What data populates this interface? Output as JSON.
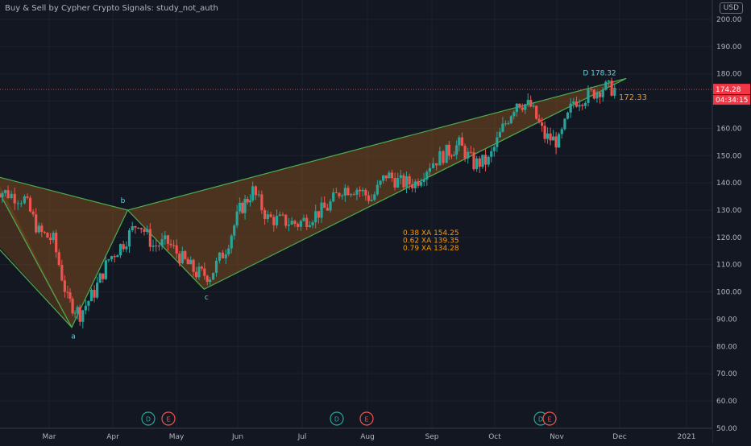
{
  "header": {
    "indicator_title": "Buy & Sell by Cypher Crypto Signals: study_not_auth",
    "currency": "USD"
  },
  "price_axis": {
    "ticks": [
      "200.00",
      "190.00",
      "180.00",
      "170.00",
      "160.00",
      "150.00",
      "140.00",
      "130.00",
      "120.00",
      "110.00",
      "100.00",
      "90.00",
      "80.00",
      "70.00",
      "60.00",
      "50.00"
    ],
    "current_price": "174.28",
    "countdown": "04:34:15"
  },
  "time_axis": {
    "labels": [
      "Mar",
      "Apr",
      "May",
      "Jun",
      "Jul",
      "Aug",
      "Sep",
      "Oct",
      "Nov",
      "Dec",
      "2021"
    ]
  },
  "pattern": {
    "points": [
      {
        "label": "",
        "x": "Feb 1",
        "y": 143
      },
      {
        "label": "a",
        "x": "Mar 12",
        "y": 87
      },
      {
        "label": "b",
        "x": "Apr 8",
        "y": 130
      },
      {
        "label": "c",
        "x": "May 15",
        "y": 101
      },
      {
        "label": "D 178.32",
        "x": "Dec 4",
        "y": 178.32
      }
    ],
    "fill_color": "#7a4a1e",
    "line_color": "#4caf50"
  },
  "fib_levels": [
    {
      "text": "0.38 XA  154.25"
    },
    {
      "text": "0.62 XA  139.35"
    },
    {
      "text": "0.79 XA  134.28"
    }
  ],
  "target_label": "172.33",
  "events": [
    {
      "type": "D",
      "color": "#26a69a"
    },
    {
      "type": "E",
      "color": "#ef5350"
    },
    {
      "type": "D",
      "color": "#26a69a"
    },
    {
      "type": "E",
      "color": "#ef5350"
    },
    {
      "type": "D",
      "color": "#26a69a"
    },
    {
      "type": "E",
      "color": "#ef5350"
    }
  ],
  "colors": {
    "background": "#131722",
    "up": "#26a69a",
    "down": "#ef5350",
    "grid": "#1e222d",
    "axis_text": "#b2b5be",
    "price_label": "#f23645",
    "fib_text": "#ff9800",
    "pattern_label": "#5fd4dc"
  },
  "chart_data": {
    "type": "candlestick",
    "title": "",
    "ylim": [
      50,
      200
    ],
    "grid": true,
    "points_approx_close": [
      {
        "x": "Feb 3",
        "close": 138
      },
      {
        "x": "Feb 10",
        "close": 136
      },
      {
        "x": "Feb 18",
        "close": 134
      },
      {
        "x": "Feb 25",
        "close": 122
      },
      {
        "x": "Mar 3",
        "close": 119
      },
      {
        "x": "Mar 10",
        "close": 97
      },
      {
        "x": "Mar 16",
        "close": 92
      },
      {
        "x": "Mar 23",
        "close": 100
      },
      {
        "x": "Mar 30",
        "close": 112
      },
      {
        "x": "Apr 6",
        "close": 118
      },
      {
        "x": "Apr 13",
        "close": 126
      },
      {
        "x": "Apr 20",
        "close": 117
      },
      {
        "x": "Apr 27",
        "close": 118
      },
      {
        "x": "May 4",
        "close": 112
      },
      {
        "x": "May 11",
        "close": 107
      },
      {
        "x": "May 18",
        "close": 106
      },
      {
        "x": "May 26",
        "close": 116
      },
      {
        "x": "Jun 2",
        "close": 130
      },
      {
        "x": "Jun 8",
        "close": 137
      },
      {
        "x": "Jun 15",
        "close": 127
      },
      {
        "x": "Jun 22",
        "close": 126
      },
      {
        "x": "Jun 29",
        "close": 125
      },
      {
        "x": "Jul 6",
        "close": 128
      },
      {
        "x": "Jul 13",
        "close": 131
      },
      {
        "x": "Jul 20",
        "close": 138
      },
      {
        "x": "Jul 27",
        "close": 138
      },
      {
        "x": "Aug 3",
        "close": 134
      },
      {
        "x": "Aug 10",
        "close": 143
      },
      {
        "x": "Aug 17",
        "close": 140
      },
      {
        "x": "Aug 24",
        "close": 140
      },
      {
        "x": "Aug 31",
        "close": 147
      },
      {
        "x": "Sep 8",
        "close": 151
      },
      {
        "x": "Sep 14",
        "close": 154
      },
      {
        "x": "Sep 21",
        "close": 147
      },
      {
        "x": "Sep 28",
        "close": 148
      },
      {
        "x": "Oct 5",
        "close": 160
      },
      {
        "x": "Oct 12",
        "close": 170
      },
      {
        "x": "Oct 19",
        "close": 168
      },
      {
        "x": "Oct 26",
        "close": 157
      },
      {
        "x": "Nov 2",
        "close": 155
      },
      {
        "x": "Nov 9",
        "close": 170
      },
      {
        "x": "Nov 16",
        "close": 172
      },
      {
        "x": "Nov 23",
        "close": 175
      },
      {
        "x": "Nov 30",
        "close": 174.28
      }
    ]
  }
}
